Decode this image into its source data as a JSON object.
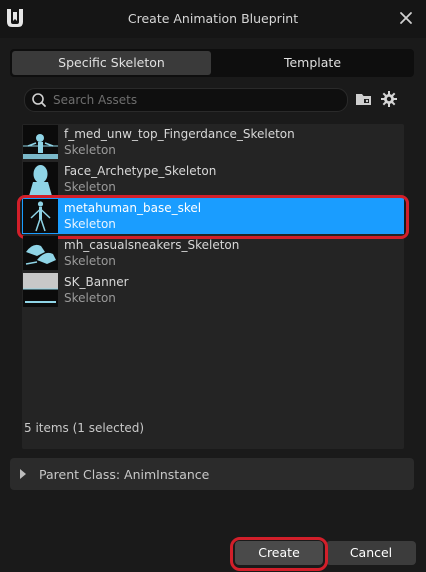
{
  "window": {
    "title": "Create Animation Blueprint"
  },
  "tabs": [
    {
      "label": "Specific Skeleton",
      "active": true
    },
    {
      "label": "Template",
      "active": false
    }
  ],
  "search": {
    "placeholder": "Search Assets"
  },
  "assets": [
    {
      "name": "f_med_unw_top_Fingerdance_Skeleton",
      "type": "Skeleton",
      "selected": false
    },
    {
      "name": "Face_Archetype_Skeleton",
      "type": "Skeleton",
      "selected": false
    },
    {
      "name": "metahuman_base_skel",
      "type": "Skeleton",
      "selected": true
    },
    {
      "name": "mh_casualsneakers_Skeleton",
      "type": "Skeleton",
      "selected": false
    },
    {
      "name": "SK_Banner",
      "type": "Skeleton",
      "selected": false
    }
  ],
  "status": {
    "count_text": "5 items (1 selected)"
  },
  "parent_class": {
    "label": "Parent Class: AnimInstance"
  },
  "buttons": {
    "create": "Create",
    "cancel": "Cancel"
  },
  "colors": {
    "selection": "#1a9dff",
    "annotation_ring": "#d21f2a",
    "thumb_mesh": "#8fd4e6"
  },
  "icons": [
    "unreal-logo-icon",
    "close-icon",
    "search-icon",
    "folder-icon",
    "gear-icon",
    "chevron-right-icon"
  ]
}
